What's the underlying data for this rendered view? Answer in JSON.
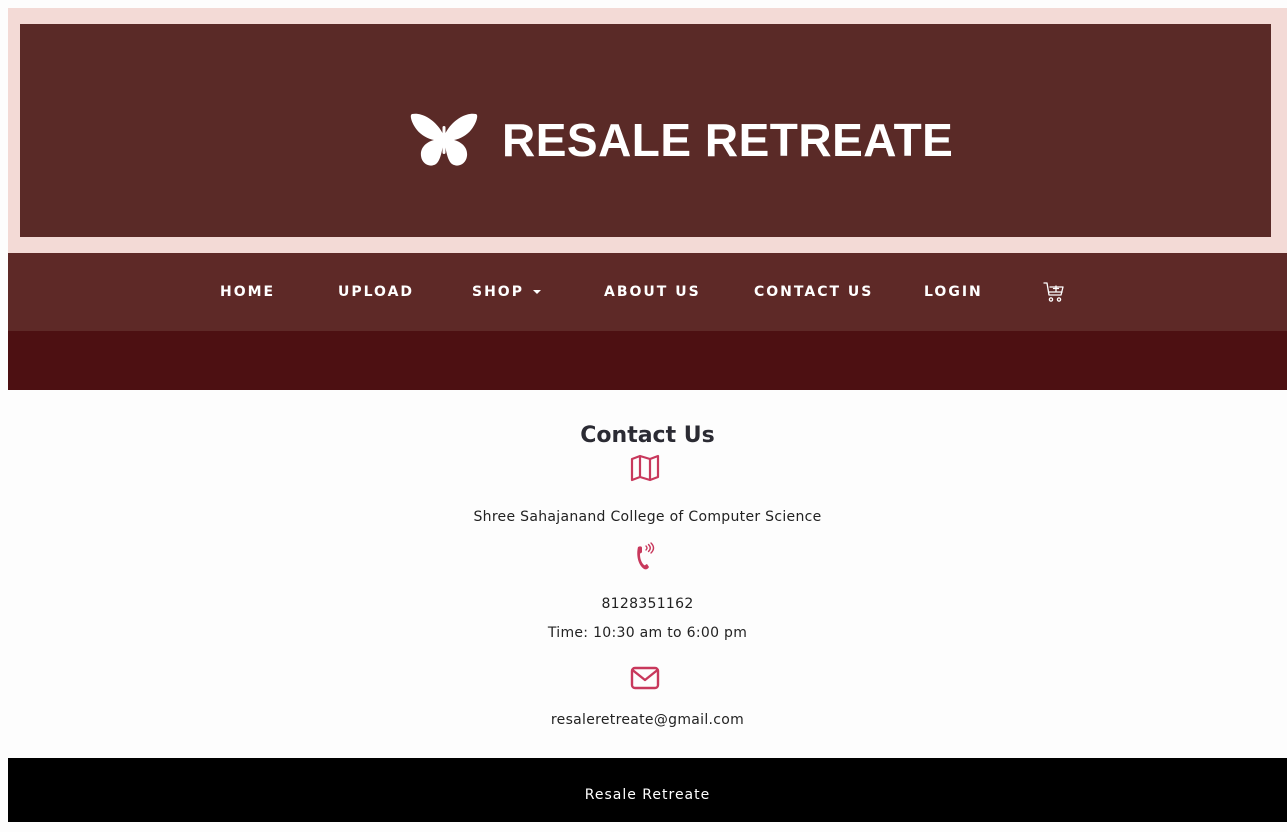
{
  "brand": {
    "logo_alt": "butterfly",
    "name": "RESALE RETREATE",
    "banner_color": "#5a2a27",
    "banner_border_color": "#f3dad6"
  },
  "nav": {
    "home": "HOME",
    "upload": "UPLOAD",
    "shop": "SHOP",
    "about": "ABOUT US",
    "contact": "CONTACT US",
    "login": "LOGIN",
    "cart_icon": "cart-icon",
    "bg_color": "#5e2927"
  },
  "contact": {
    "title": "Contact Us",
    "map_icon": "map-icon",
    "address": "Shree Sahajanand College of Computer Science",
    "phone_icon": "phone-icon",
    "phone": "8128351162",
    "hours": "Time: 10:30 am to 6:00 pm",
    "mail_icon": "mail-icon",
    "email": "resaleretreate@gmail.com",
    "icon_color": "#c8385c"
  },
  "footer": {
    "text": "Resale Retreate"
  }
}
